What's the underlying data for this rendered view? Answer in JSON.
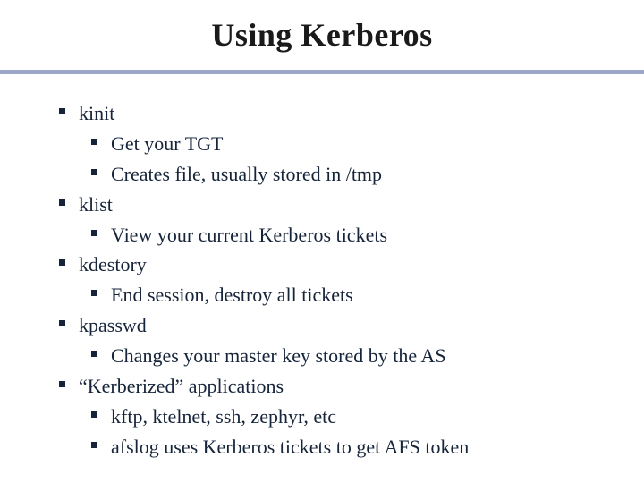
{
  "title": "Using Kerberos",
  "items": [
    {
      "label": "kinit",
      "sub": [
        "Get your TGT",
        "Creates file, usually stored in /tmp"
      ]
    },
    {
      "label": "klist",
      "sub": [
        "View your current Kerberos tickets"
      ]
    },
    {
      "label": "kdestory",
      "sub": [
        "End session, destroy all tickets"
      ]
    },
    {
      "label": "kpasswd",
      "sub": [
        "Changes your master key stored by the AS"
      ]
    },
    {
      "label": "“Kerberized” applications",
      "sub": [
        "kftp, ktelnet, ssh, zephyr, etc",
        "afslog uses Kerberos tickets to get AFS token"
      ]
    }
  ]
}
